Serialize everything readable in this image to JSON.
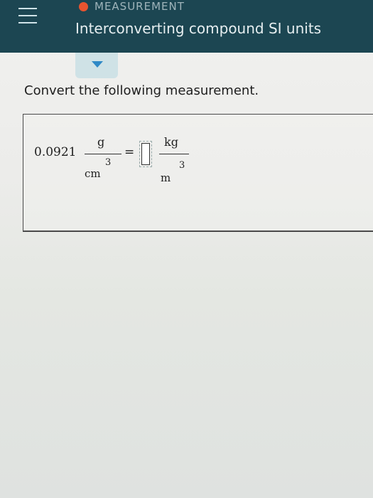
{
  "header": {
    "menu_icon": "hamburger-menu-icon",
    "topic": "MEASUREMENT",
    "status_color": "#e8542f",
    "title": "Interconverting compound SI units",
    "background_color": "#1c4652"
  },
  "dropdown": {
    "icon": "caret-down-icon",
    "accent_color": "#2f89c6"
  },
  "question": {
    "instruction": "Convert the following measurement."
  },
  "expression": {
    "value": "0.0921",
    "from_unit": {
      "numerator": "g",
      "denominator": "cm",
      "exponent": "3"
    },
    "equals": "=",
    "answer": "",
    "to_unit": {
      "numerator": "kg",
      "denominator": "m",
      "exponent": "3"
    }
  }
}
